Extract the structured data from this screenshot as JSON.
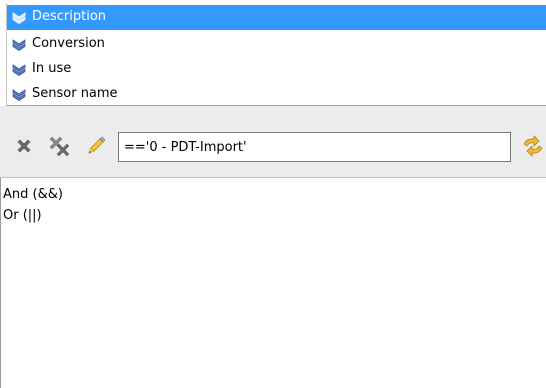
{
  "fields": {
    "items": [
      {
        "label": "Description",
        "icon": "chevron-double-down-icon",
        "selected": true
      },
      {
        "label": "Conversion",
        "icon": "chevron-double-down-icon",
        "selected": false
      },
      {
        "label": "In use",
        "icon": "chevron-double-down-icon",
        "selected": false
      },
      {
        "label": "Sensor name",
        "icon": "chevron-double-down-icon",
        "selected": false
      }
    ]
  },
  "toolbar": {
    "buttons": [
      {
        "name": "delete",
        "icon": "x-icon"
      },
      {
        "name": "clear-all",
        "icon": "multi-x-icon"
      },
      {
        "name": "edit",
        "icon": "pencil-icon"
      }
    ],
    "filter_value": "=='0 - PDT-Import'",
    "apply_icon": "refresh-arrows-icon"
  },
  "operators": {
    "items": [
      {
        "label": "And (&&)"
      },
      {
        "label": "Or (||)"
      }
    ]
  },
  "colors": {
    "selection": "#3399ff",
    "toolbar_bg": "#ececec",
    "icon_grey": "#6e6e6e",
    "chevron_fill": "#5b7ec8"
  }
}
